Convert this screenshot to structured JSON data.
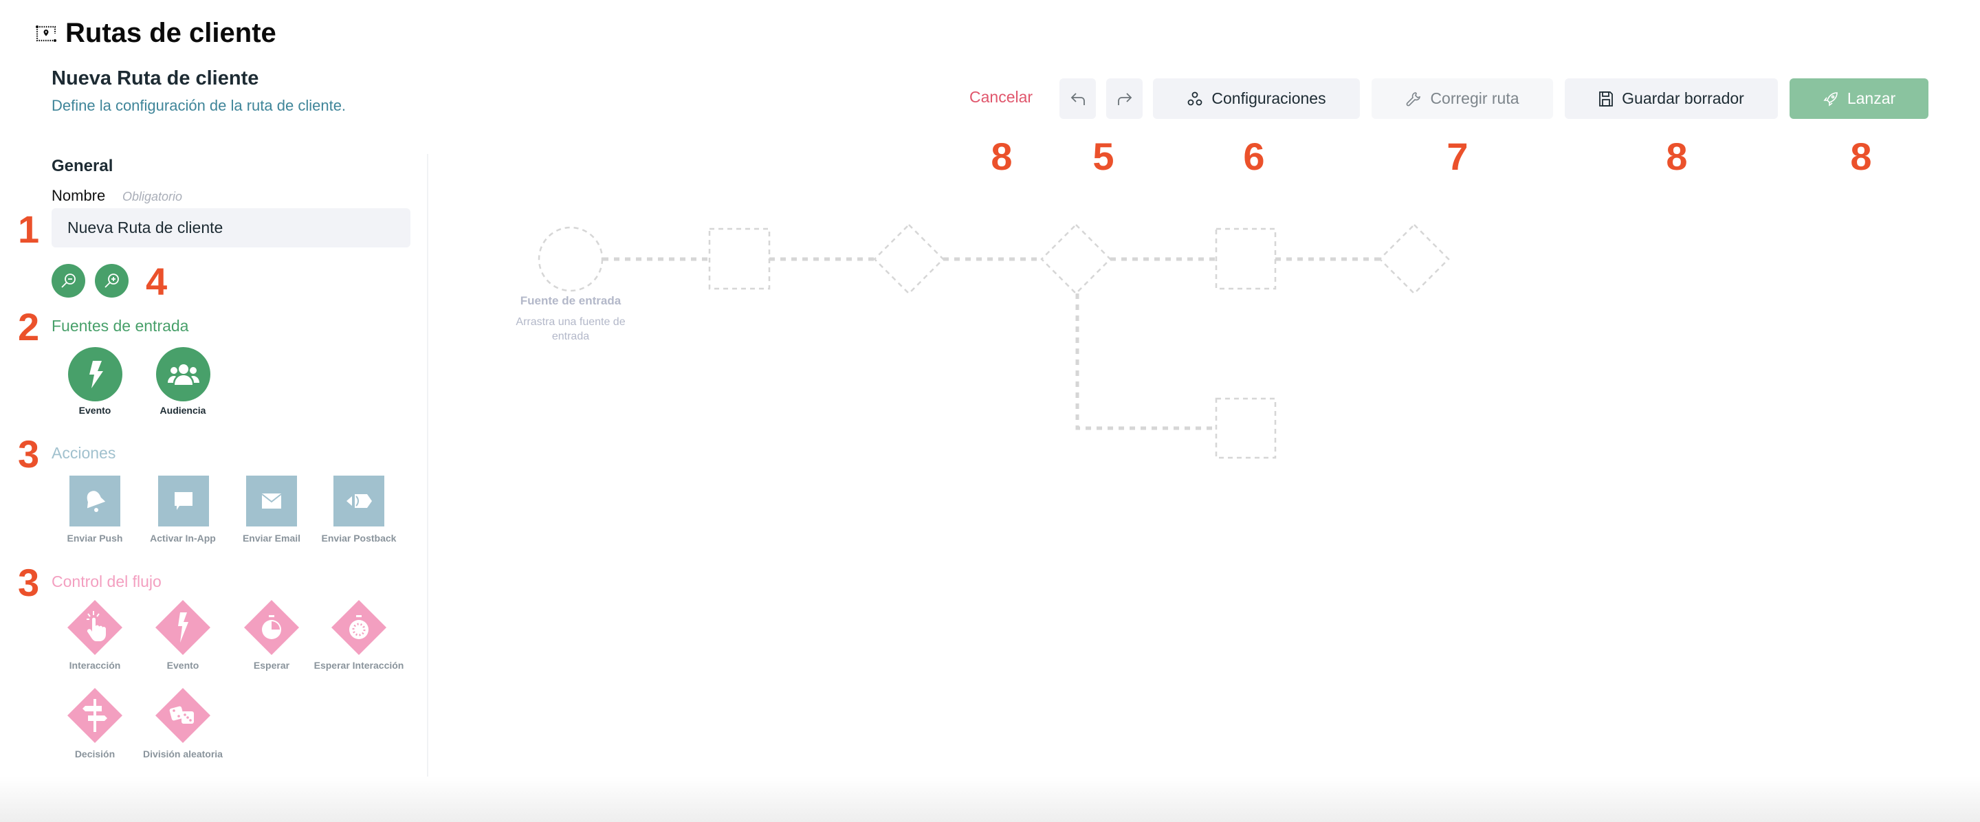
{
  "header": {
    "title": "Rutas de cliente",
    "subtitle": "Nueva Ruta de cliente",
    "description": "Define la configuración de la ruta de cliente.",
    "title_icon": "journey-map-icon"
  },
  "sidebar": {
    "general_label": "General",
    "name_field": {
      "label": "Nombre",
      "hint": "Obligatorio",
      "value": "Nueva Ruta de cliente"
    },
    "zoom_buttons": [
      {
        "name": "zoom-out",
        "icon": "zoom-out-icon"
      },
      {
        "name": "zoom-in",
        "icon": "zoom-in-icon"
      }
    ],
    "entry_sources": {
      "title": "Fuentes de entrada",
      "color": "#48a06a",
      "items": [
        {
          "label": "Evento",
          "icon": "lightning-icon"
        },
        {
          "label": "Audiencia",
          "icon": "users-icon"
        }
      ]
    },
    "actions": {
      "title": "Acciones",
      "color": "#a1c1ce",
      "items": [
        {
          "label": "Enviar Push",
          "icon": "bell-icon"
        },
        {
          "label": "Activar In-App",
          "icon": "chat-bubble-icon"
        },
        {
          "label": "Enviar Email",
          "icon": "envelope-icon"
        },
        {
          "label": "Enviar Postback",
          "icon": "postback-icon"
        }
      ]
    },
    "flow_control": {
      "title": "Control del flujo",
      "color": "#f39fc0",
      "items": [
        {
          "label": "Interacción",
          "icon": "tap-icon"
        },
        {
          "label": "Evento",
          "icon": "lightning-icon"
        },
        {
          "label": "Esperar",
          "icon": "stopwatch-icon"
        },
        {
          "label": "Esperar Interacción",
          "icon": "stopwatch-dashed-icon"
        },
        {
          "label": "Decisión",
          "icon": "signpost-icon"
        },
        {
          "label": "División aleatoria",
          "icon": "dice-icon"
        }
      ]
    }
  },
  "toolbar": {
    "cancel": "Cancelar",
    "undo_icon": "undo-icon",
    "redo_icon": "redo-icon",
    "settings": "Configuraciones",
    "fix_route": "Corregir ruta",
    "save_draft": "Guardar borrador",
    "launch": "Lanzar",
    "launch_color": "#8ac39f"
  },
  "canvas": {
    "entry_node_title": "Fuente de entrada",
    "entry_node_hint": "Arrastra una fuente de entrada"
  },
  "annotations": {
    "input": "1",
    "sources": "2",
    "actions": "3",
    "flow": "3",
    "zoom": "4",
    "cancel": "8",
    "undo_redo": "5",
    "settings": "6",
    "fix": "7",
    "save": "8",
    "launch": "8"
  }
}
